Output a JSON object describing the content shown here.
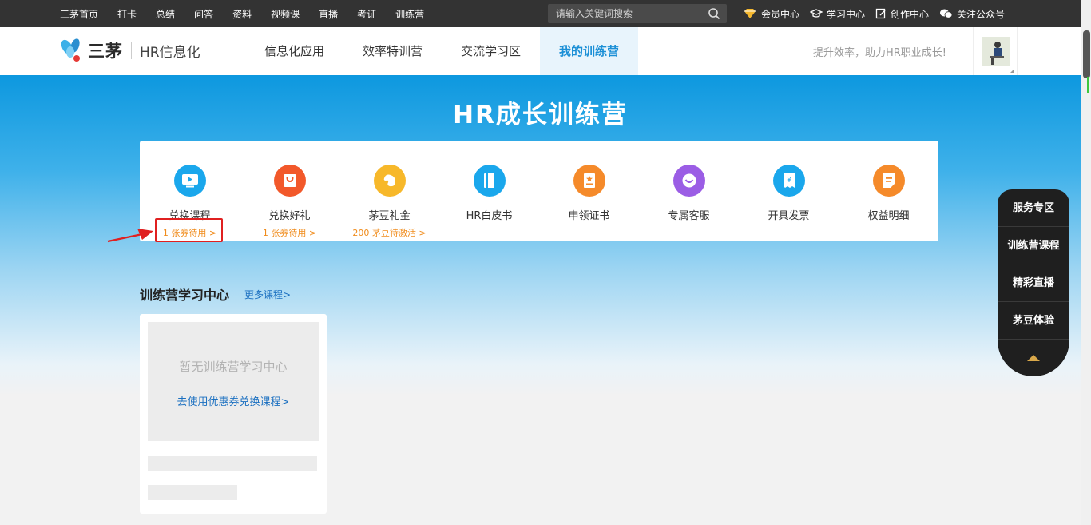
{
  "topbar": {
    "nav": [
      "三茅首页",
      "打卡",
      "总结",
      "问答",
      "资料",
      "视频课",
      "直播",
      "考证",
      "训练营"
    ],
    "search_placeholder": "请输入关键词搜索",
    "links": {
      "vip": "会员中心",
      "study": "学习中心",
      "create": "创作中心",
      "follow": "关注公众号"
    }
  },
  "header": {
    "brand": "三茅",
    "sub": "HR信息化",
    "nav": [
      {
        "label": "信息化应用"
      },
      {
        "label": "效率特训营"
      },
      {
        "label": "交流学习区"
      },
      {
        "label": "我的训练营"
      }
    ],
    "slogan": "提升效率，助力HR职业成长!"
  },
  "banner": {
    "title": "HR成长训练营"
  },
  "services": [
    {
      "label": "兑换课程",
      "sub": "1 张券待用 >",
      "color": "#1aa7ec"
    },
    {
      "label": "兑换好礼",
      "sub": "1 张券待用 >",
      "color": "#f2582a"
    },
    {
      "label": "茅豆礼金",
      "sub": "200 茅豆待激活 >",
      "color": "#f7b82a"
    },
    {
      "label": "HR白皮书",
      "sub": "",
      "color": "#1aa7ec"
    },
    {
      "label": "申领证书",
      "sub": "",
      "color": "#f58a2a"
    },
    {
      "label": "专属客服",
      "sub": "",
      "color": "#9b5de5"
    },
    {
      "label": "开具发票",
      "sub": "",
      "color": "#1aa7ec"
    },
    {
      "label": "权益明细",
      "sub": "",
      "color": "#f58a2a"
    }
  ],
  "learning": {
    "title": "训练营学习中心",
    "more": "更多课程>",
    "empty_text": "暂无训练营学习中心",
    "go_link": "去使用优惠券兑换课程>"
  },
  "sidebar": {
    "items": [
      "服务专区",
      "训练营课程",
      "精彩直播",
      "茅豆体验"
    ]
  }
}
